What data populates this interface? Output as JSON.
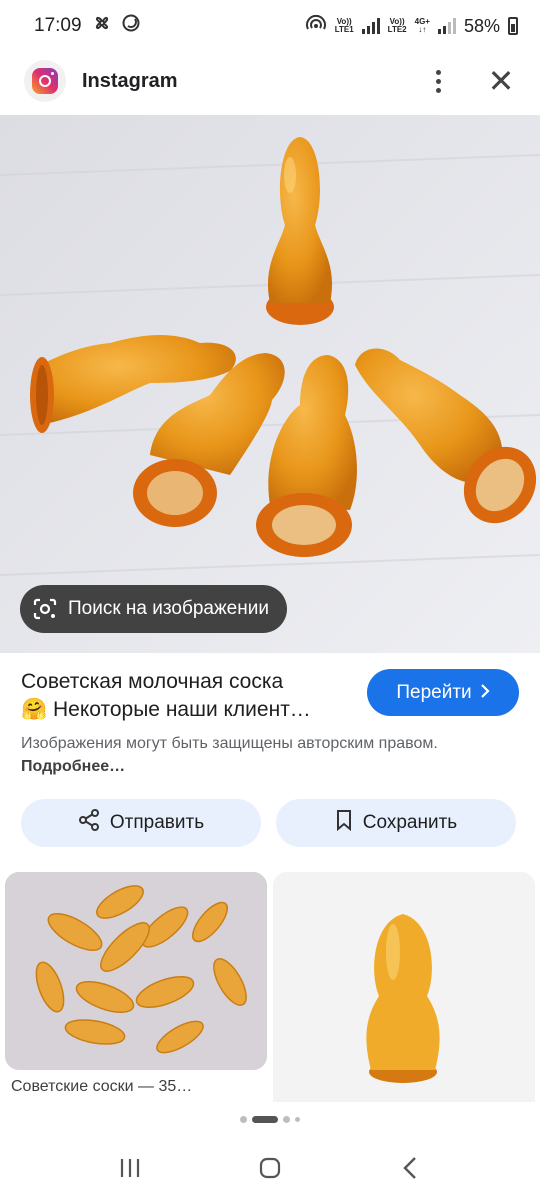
{
  "status_bar": {
    "time": "17:09",
    "sim1": "LTE1",
    "sim2": "LTE2",
    "network": "4G+",
    "volte": "Vo))",
    "battery": "58%"
  },
  "app_header": {
    "app_name": "Instagram"
  },
  "main_image": {
    "lens_label": "Поиск на изображении"
  },
  "result": {
    "title_line1": "Советская молочная соска",
    "title_line2": "🤗 Некоторые наши клиент…",
    "visit_label": "Перейти",
    "copyright_text": "Изображения могут быть защищены авторским правом.",
    "copyright_more": "Подробнее…"
  },
  "actions": {
    "share_label": "Отправить",
    "save_label": "Сохранить"
  },
  "related": {
    "items": [
      {
        "caption": "Советские соски — 35…"
      },
      {
        "caption": ""
      }
    ]
  },
  "pager": {
    "count": 4,
    "active": 1
  },
  "colors": {
    "accent": "#1a73e8",
    "chip_bg": "#e8f0fe",
    "nipple": "#e8961a"
  },
  "icons": [
    "instagram-logo-icon",
    "more-vert-icon",
    "close-icon",
    "lens-icon",
    "chevron-right-icon",
    "share-icon",
    "bookmark-icon",
    "recents-icon",
    "home-icon",
    "back-icon"
  ]
}
